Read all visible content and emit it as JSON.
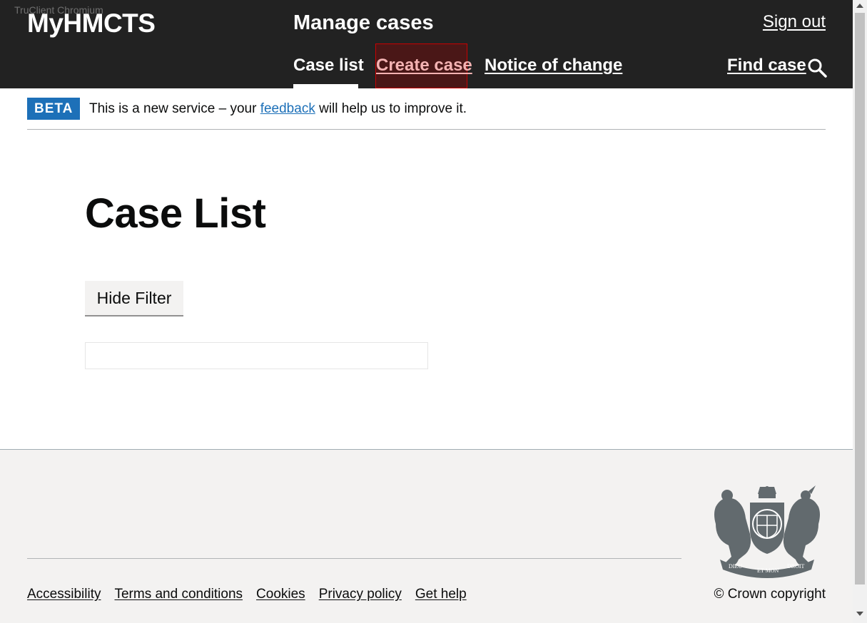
{
  "overlay_title": "TruClient Chromium",
  "header": {
    "logo": "MyHMCTS",
    "service_name": "Manage cases",
    "sign_out": "Sign out",
    "nav": {
      "case_list": "Case list",
      "create_case": "Create case",
      "notice_of_change": "Notice of change"
    },
    "find_case": "Find case",
    "search_icon": "search-icon"
  },
  "phase_banner": {
    "tag": "BETA",
    "text_before": "This is a new service – your ",
    "link": "feedback",
    "text_after": " will help us to improve it."
  },
  "main": {
    "title": "Case List",
    "filter_button": "Hide Filter"
  },
  "footer": {
    "links": [
      "Accessibility",
      "Terms and conditions",
      "Cookies",
      "Privacy policy",
      "Get help"
    ],
    "copyright": "© Crown copyright",
    "crest_icon": "royal-coat-of-arms-icon",
    "crest_text": {
      "motto_left": "DIEU",
      "motto_mid": "ET MON",
      "motto_right": "DROIT"
    }
  },
  "colors": {
    "header_bg": "#222222",
    "tag_blue": "#1d70b8",
    "link_blue": "#1d70b8",
    "highlight_red": "#c80000",
    "footer_bg": "#f3f2f1"
  }
}
